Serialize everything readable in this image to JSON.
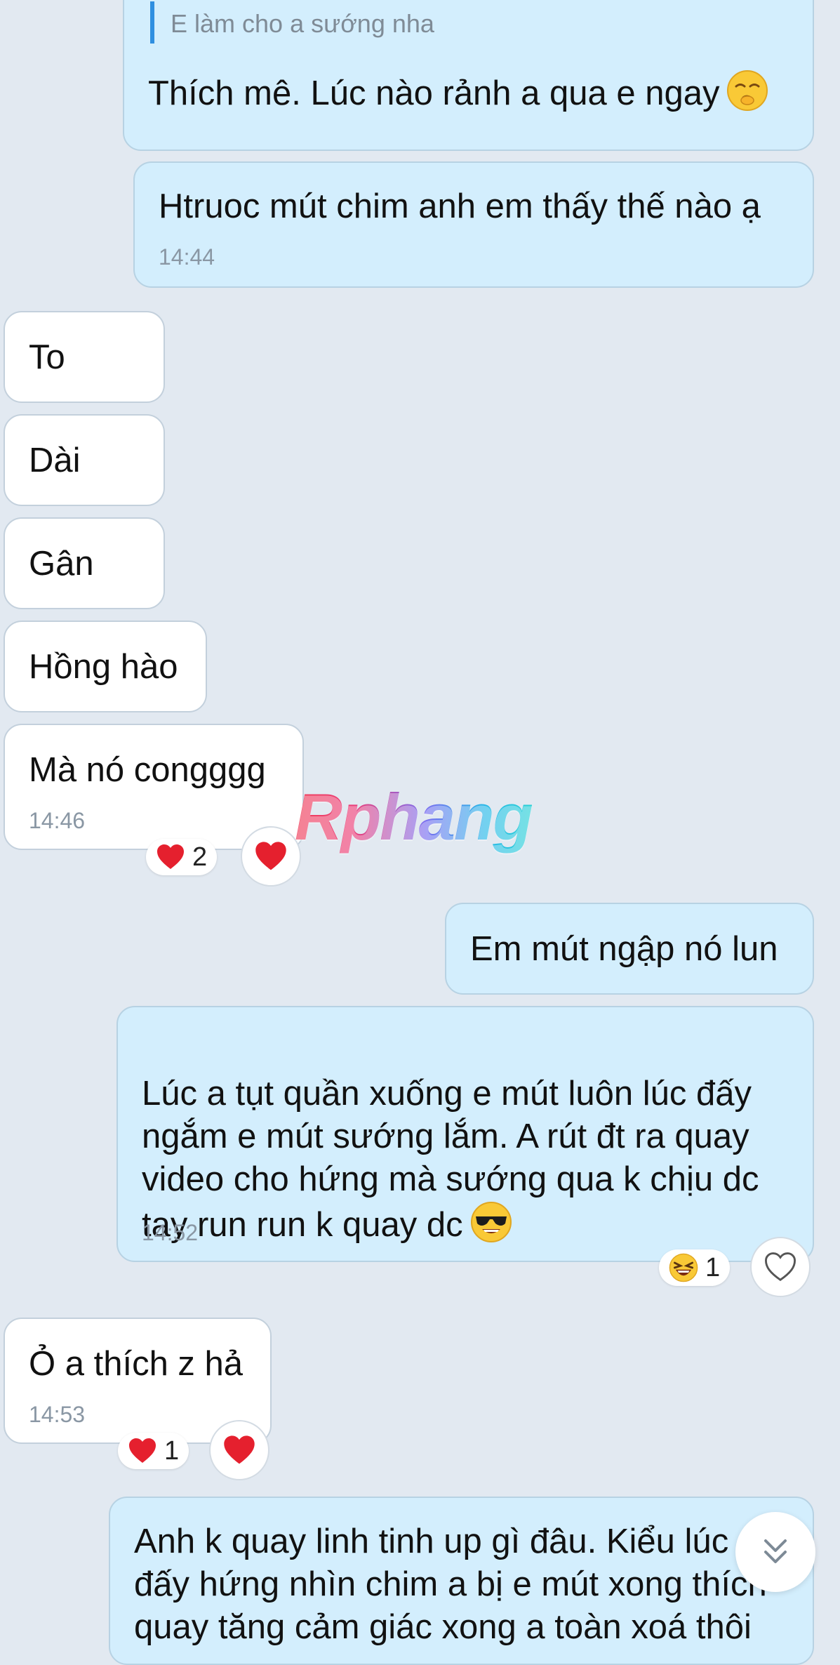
{
  "messages": {
    "m1": {
      "quote": "E làm cho a sướng nha",
      "text": "Thích mê. Lúc nào rảnh a qua e ngay",
      "emoji": "smirking-face-emoji"
    },
    "m2": {
      "text": "Htruoc mút chim anh em thấy thế nào ạ",
      "time": "14:44"
    },
    "m3": {
      "text": "To"
    },
    "m4": {
      "text": "Dài"
    },
    "m5": {
      "text": "Gân"
    },
    "m6": {
      "text": "Hồng hào"
    },
    "m7": {
      "text": "Mà nó congggg",
      "time": "14:46",
      "reaction_count": "2",
      "reaction_icon": "heart-icon"
    },
    "m8": {
      "text": "Em mút ngập nó lun"
    },
    "m9": {
      "text": "Lúc a tụt quần xuống e mút luôn lúc đấy\nngắm e mút sướng lắm. A rút đt ra quay\nvideo cho hứng mà sướng qua k chịu dc\ntay run run k quay dc",
      "emoji": "smiling-face-with-sunglasses-emoji",
      "time": "14:52",
      "reaction_count": "1",
      "reaction_icon": "laughing-face-emoji"
    },
    "m10": {
      "text": "Ỏ a thích z hả",
      "time": "14:53",
      "reaction_count": "1",
      "reaction_icon": "heart-icon"
    },
    "m11": {
      "text": "Anh k quay linh tinh up gì đâu. Kiểu lúc\nđấy hứng nhìn chim a bị e mút xong thích\nquay tăng cảm giác xong a toàn xoá thôi"
    }
  },
  "watermark": "Rphang",
  "icons": {
    "scroll_down": "double-chevron-down-icon",
    "empty_reaction": "heart-outline-icon"
  },
  "colors": {
    "background": "#e2e9f1",
    "outgoing_bubble": "#d3eefd",
    "incoming_bubble": "#ffffff",
    "quote_bar": "#2f8fe0",
    "heart": "#e5202e",
    "timestamp": "#8a97a4"
  }
}
